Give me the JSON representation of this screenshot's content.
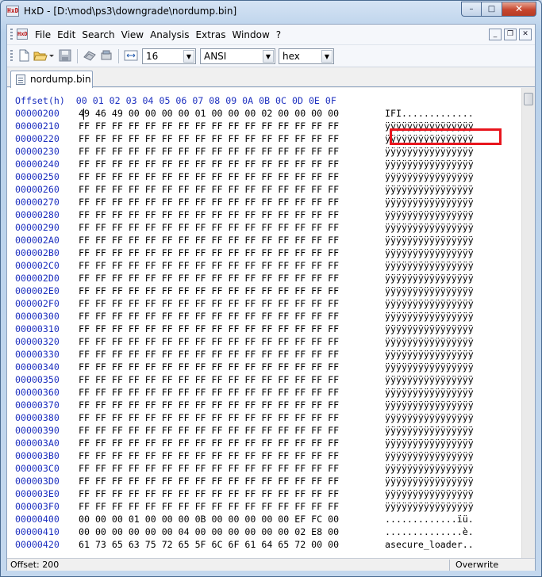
{
  "window": {
    "title": "HxD - [D:\\mod\\ps3\\downgrade\\nordump.bin]",
    "app_icon_text": "HxD",
    "buttons": {
      "minimize": "–",
      "maximize": "□",
      "close": "✕"
    }
  },
  "menu": {
    "items": [
      "File",
      "Edit",
      "Search",
      "View",
      "Analysis",
      "Extras",
      "Window",
      "?"
    ],
    "mdi": {
      "minimize": "_",
      "restore": "❐",
      "close": "✕"
    }
  },
  "toolbar": {
    "bytes_per_row": "16",
    "charset": "ANSI",
    "offset_base": "hex"
  },
  "tab": {
    "label": "nordump.bin"
  },
  "editor": {
    "header": "Offset(h)  00 01 02 03 04 05 06 07 08 09 0A 0B 0C 0D 0E 0F",
    "rows": [
      {
        "offset": "00000200",
        "hex": "49 46 49 00 00 00 00 01 00 00 00 02 00 00 00 00",
        "ascii": "IFI............."
      },
      {
        "offset": "00000210",
        "hex": "FF FF FF FF FF FF FF FF FF FF FF FF FF FF FF FF",
        "ascii": "ÿÿÿÿÿÿÿÿÿÿÿÿÿÿÿÿ"
      },
      {
        "offset": "00000220",
        "hex": "FF FF FF FF FF FF FF FF FF FF FF FF FF FF FF FF",
        "ascii": "ÿÿÿÿÿÿÿÿÿÿÿÿÿÿÿÿ"
      },
      {
        "offset": "00000230",
        "hex": "FF FF FF FF FF FF FF FF FF FF FF FF FF FF FF FF",
        "ascii": "ÿÿÿÿÿÿÿÿÿÿÿÿÿÿÿÿ"
      },
      {
        "offset": "00000240",
        "hex": "FF FF FF FF FF FF FF FF FF FF FF FF FF FF FF FF",
        "ascii": "ÿÿÿÿÿÿÿÿÿÿÿÿÿÿÿÿ"
      },
      {
        "offset": "00000250",
        "hex": "FF FF FF FF FF FF FF FF FF FF FF FF FF FF FF FF",
        "ascii": "ÿÿÿÿÿÿÿÿÿÿÿÿÿÿÿÿ"
      },
      {
        "offset": "00000260",
        "hex": "FF FF FF FF FF FF FF FF FF FF FF FF FF FF FF FF",
        "ascii": "ÿÿÿÿÿÿÿÿÿÿÿÿÿÿÿÿ"
      },
      {
        "offset": "00000270",
        "hex": "FF FF FF FF FF FF FF FF FF FF FF FF FF FF FF FF",
        "ascii": "ÿÿÿÿÿÿÿÿÿÿÿÿÿÿÿÿ"
      },
      {
        "offset": "00000280",
        "hex": "FF FF FF FF FF FF FF FF FF FF FF FF FF FF FF FF",
        "ascii": "ÿÿÿÿÿÿÿÿÿÿÿÿÿÿÿÿ"
      },
      {
        "offset": "00000290",
        "hex": "FF FF FF FF FF FF FF FF FF FF FF FF FF FF FF FF",
        "ascii": "ÿÿÿÿÿÿÿÿÿÿÿÿÿÿÿÿ"
      },
      {
        "offset": "000002A0",
        "hex": "FF FF FF FF FF FF FF FF FF FF FF FF FF FF FF FF",
        "ascii": "ÿÿÿÿÿÿÿÿÿÿÿÿÿÿÿÿ"
      },
      {
        "offset": "000002B0",
        "hex": "FF FF FF FF FF FF FF FF FF FF FF FF FF FF FF FF",
        "ascii": "ÿÿÿÿÿÿÿÿÿÿÿÿÿÿÿÿ"
      },
      {
        "offset": "000002C0",
        "hex": "FF FF FF FF FF FF FF FF FF FF FF FF FF FF FF FF",
        "ascii": "ÿÿÿÿÿÿÿÿÿÿÿÿÿÿÿÿ"
      },
      {
        "offset": "000002D0",
        "hex": "FF FF FF FF FF FF FF FF FF FF FF FF FF FF FF FF",
        "ascii": "ÿÿÿÿÿÿÿÿÿÿÿÿÿÿÿÿ"
      },
      {
        "offset": "000002E0",
        "hex": "FF FF FF FF FF FF FF FF FF FF FF FF FF FF FF FF",
        "ascii": "ÿÿÿÿÿÿÿÿÿÿÿÿÿÿÿÿ"
      },
      {
        "offset": "000002F0",
        "hex": "FF FF FF FF FF FF FF FF FF FF FF FF FF FF FF FF",
        "ascii": "ÿÿÿÿÿÿÿÿÿÿÿÿÿÿÿÿ"
      },
      {
        "offset": "00000300",
        "hex": "FF FF FF FF FF FF FF FF FF FF FF FF FF FF FF FF",
        "ascii": "ÿÿÿÿÿÿÿÿÿÿÿÿÿÿÿÿ"
      },
      {
        "offset": "00000310",
        "hex": "FF FF FF FF FF FF FF FF FF FF FF FF FF FF FF FF",
        "ascii": "ÿÿÿÿÿÿÿÿÿÿÿÿÿÿÿÿ"
      },
      {
        "offset": "00000320",
        "hex": "FF FF FF FF FF FF FF FF FF FF FF FF FF FF FF FF",
        "ascii": "ÿÿÿÿÿÿÿÿÿÿÿÿÿÿÿÿ"
      },
      {
        "offset": "00000330",
        "hex": "FF FF FF FF FF FF FF FF FF FF FF FF FF FF FF FF",
        "ascii": "ÿÿÿÿÿÿÿÿÿÿÿÿÿÿÿÿ"
      },
      {
        "offset": "00000340",
        "hex": "FF FF FF FF FF FF FF FF FF FF FF FF FF FF FF FF",
        "ascii": "ÿÿÿÿÿÿÿÿÿÿÿÿÿÿÿÿ"
      },
      {
        "offset": "00000350",
        "hex": "FF FF FF FF FF FF FF FF FF FF FF FF FF FF FF FF",
        "ascii": "ÿÿÿÿÿÿÿÿÿÿÿÿÿÿÿÿ"
      },
      {
        "offset": "00000360",
        "hex": "FF FF FF FF FF FF FF FF FF FF FF FF FF FF FF FF",
        "ascii": "ÿÿÿÿÿÿÿÿÿÿÿÿÿÿÿÿ"
      },
      {
        "offset": "00000370",
        "hex": "FF FF FF FF FF FF FF FF FF FF FF FF FF FF FF FF",
        "ascii": "ÿÿÿÿÿÿÿÿÿÿÿÿÿÿÿÿ"
      },
      {
        "offset": "00000380",
        "hex": "FF FF FF FF FF FF FF FF FF FF FF FF FF FF FF FF",
        "ascii": "ÿÿÿÿÿÿÿÿÿÿÿÿÿÿÿÿ"
      },
      {
        "offset": "00000390",
        "hex": "FF FF FF FF FF FF FF FF FF FF FF FF FF FF FF FF",
        "ascii": "ÿÿÿÿÿÿÿÿÿÿÿÿÿÿÿÿ"
      },
      {
        "offset": "000003A0",
        "hex": "FF FF FF FF FF FF FF FF FF FF FF FF FF FF FF FF",
        "ascii": "ÿÿÿÿÿÿÿÿÿÿÿÿÿÿÿÿ"
      },
      {
        "offset": "000003B0",
        "hex": "FF FF FF FF FF FF FF FF FF FF FF FF FF FF FF FF",
        "ascii": "ÿÿÿÿÿÿÿÿÿÿÿÿÿÿÿÿ"
      },
      {
        "offset": "000003C0",
        "hex": "FF FF FF FF FF FF FF FF FF FF FF FF FF FF FF FF",
        "ascii": "ÿÿÿÿÿÿÿÿÿÿÿÿÿÿÿÿ"
      },
      {
        "offset": "000003D0",
        "hex": "FF FF FF FF FF FF FF FF FF FF FF FF FF FF FF FF",
        "ascii": "ÿÿÿÿÿÿÿÿÿÿÿÿÿÿÿÿ"
      },
      {
        "offset": "000003E0",
        "hex": "FF FF FF FF FF FF FF FF FF FF FF FF FF FF FF FF",
        "ascii": "ÿÿÿÿÿÿÿÿÿÿÿÿÿÿÿÿ"
      },
      {
        "offset": "000003F0",
        "hex": "FF FF FF FF FF FF FF FF FF FF FF FF FF FF FF FF",
        "ascii": "ÿÿÿÿÿÿÿÿÿÿÿÿÿÿÿÿ"
      },
      {
        "offset": "00000400",
        "hex": "00 00 00 01 00 00 00 0B 00 00 00 00 00 EF FC 00",
        "ascii": ".............ïü."
      },
      {
        "offset": "00000410",
        "hex": "00 00 00 00 00 00 04 00 00 00 00 00 00 02 E8 00",
        "ascii": "..............è."
      },
      {
        "offset": "00000420",
        "hex": "61 73 65 63 75 72 65 5F 6C 6F 61 64 65 72 00 00",
        "ascii": "asecure_loader.."
      }
    ]
  },
  "statusbar": {
    "offset": "Offset: 200",
    "mode": "Overwrite"
  },
  "colors": {
    "offset_blue": "#1c2fbf",
    "highlight_red": "#e8151d"
  }
}
